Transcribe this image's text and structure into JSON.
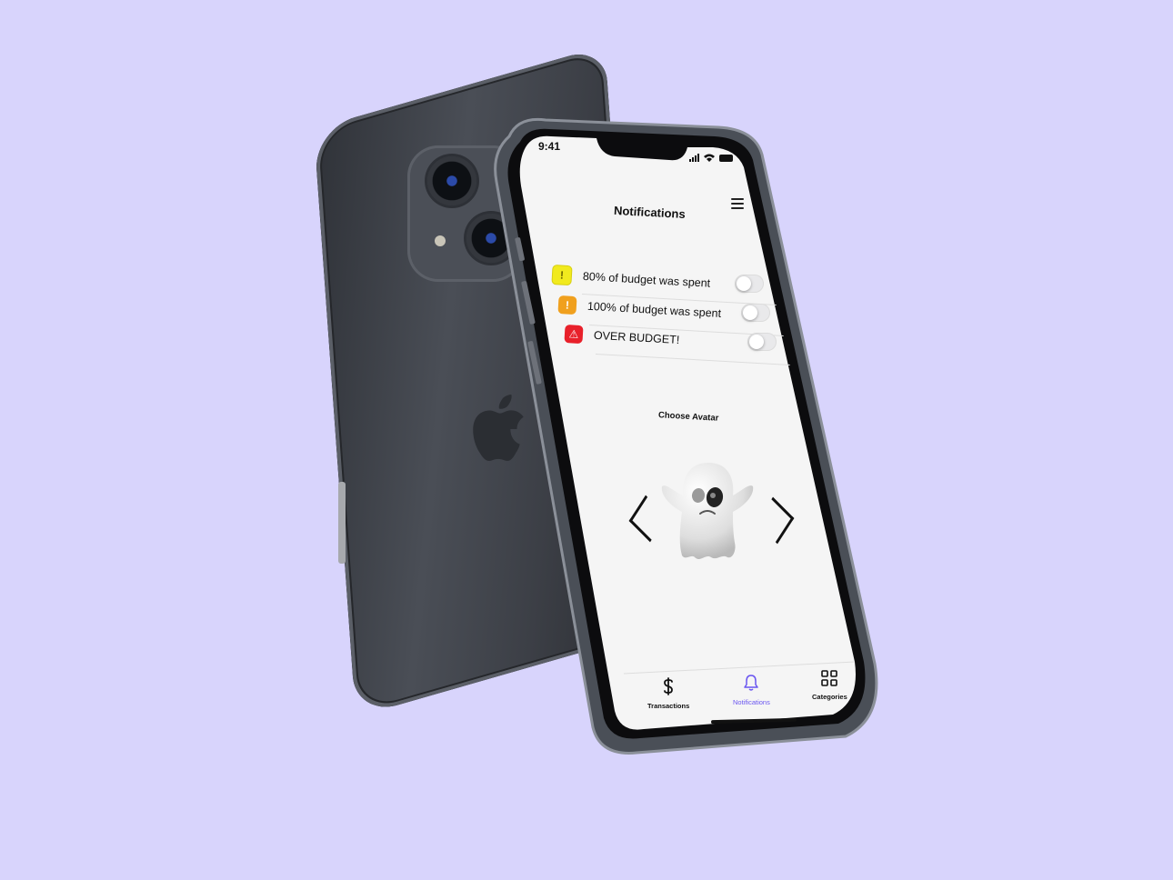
{
  "status_bar": {
    "time": "9:41"
  },
  "header": {
    "title": "Notifications",
    "menu_icon": "hamburger-menu-icon"
  },
  "notifications": [
    {
      "label": "80% of budget was spent",
      "icon": "warning-circle-icon",
      "color": "#f1ea1e",
      "enabled": false
    },
    {
      "label": "100% of budget was spent",
      "icon": "alert-circle-icon",
      "color": "#f0a01e",
      "enabled": false
    },
    {
      "label": "OVER BUDGET!",
      "icon": "warning-triangle-icon",
      "color": "#e8202a",
      "enabled": false
    }
  ],
  "avatar": {
    "heading": "Choose Avatar",
    "current": "ghost-avatar",
    "prev_icon": "chevron-left-icon",
    "next_icon": "chevron-right-icon"
  },
  "tab_bar": {
    "items": [
      {
        "label": "Transactions",
        "icon": "dollar-icon",
        "active": false
      },
      {
        "label": "Notifications",
        "icon": "bell-icon",
        "active": true
      },
      {
        "label": "Categories",
        "icon": "grid-icon",
        "active": false
      }
    ],
    "active_color": "#6a56f0"
  },
  "background_color": "#d8d4fc"
}
